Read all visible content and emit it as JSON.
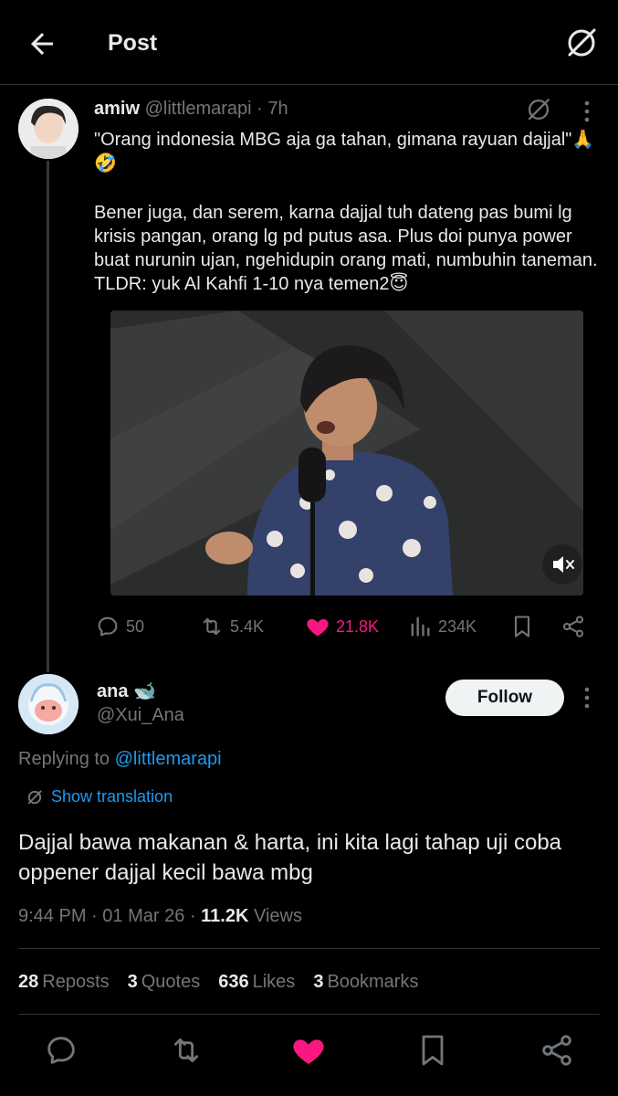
{
  "header": {
    "title": "Post",
    "back_icon": "arrow-left-icon",
    "grok_icon": "grok-icon"
  },
  "original_post": {
    "display_name": "amiw",
    "handle": "@littlemarapi",
    "separator": "·",
    "time": "7h",
    "paragraphs": [
      "\"Orang indonesia MBG aja ga tahan, gimana rayuan dajjal\"🙏🤣",
      "Bener juga, dan serem, karna dajjal tuh dateng pas bumi lg krisis pangan, orang lg pd putus asa. Plus doi punya power buat nurunin ujan, ngehidupin orang mati, numbuhin taneman. TLDR: yuk Al Kahfi 1-10 nya temen2😇"
    ],
    "media": {
      "type": "video",
      "muted": true
    },
    "actions": {
      "replies": "50",
      "reposts": "5.4K",
      "likes": "21.8K",
      "views": "234K"
    }
  },
  "reply_post": {
    "display_name": "ana 🐋",
    "handle": "@Xui_Ana",
    "follow_label": "Follow",
    "replying_prefix": "Replying to",
    "replying_to": "@littlemarapi",
    "show_translation": "Show translation",
    "text": "Dajjal bawa makanan & harta, ini kita lagi tahap uji coba oppener dajjal kecil bawa mbg",
    "time": "9:44 PM",
    "dot": "·",
    "date": "01 Mar 26",
    "views_count": "11.2K",
    "views_label": "Views",
    "stats": {
      "reposts_count": "28",
      "reposts_label": "Reposts",
      "quotes_count": "3",
      "quotes_label": "Quotes",
      "likes_count": "636",
      "likes_label": "Likes",
      "bookmarks_count": "3",
      "bookmarks_label": "Bookmarks"
    }
  },
  "colors": {
    "background": "#000000",
    "text": "#e7e9ea",
    "muted": "#71767b",
    "link": "#1d9bf0",
    "like": "#f91880",
    "divider": "#2f3336"
  }
}
